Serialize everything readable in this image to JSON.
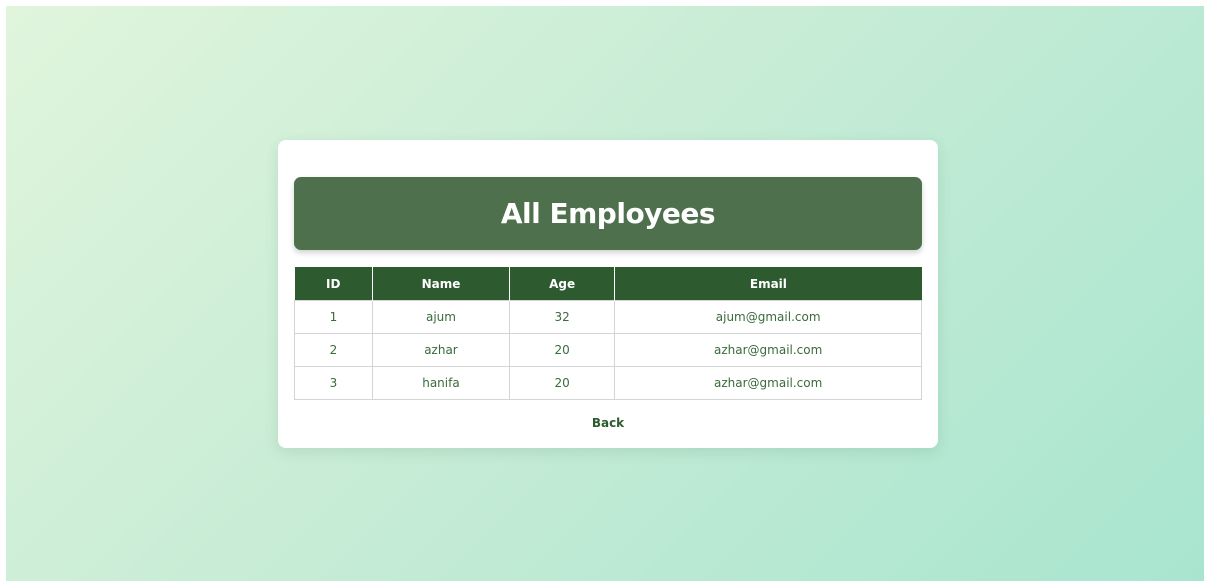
{
  "page": {
    "title": "All Employees"
  },
  "table": {
    "headers": [
      "ID",
      "Name",
      "Age",
      "Email"
    ],
    "rows": [
      {
        "id": "1",
        "name": "ajum",
        "age": "32",
        "email": "ajum@gmail.com"
      },
      {
        "id": "2",
        "name": "azhar",
        "age": "20",
        "email": "azhar@gmail.com"
      },
      {
        "id": "3",
        "name": "hanifa",
        "age": "20",
        "email": "azhar@gmail.com"
      }
    ]
  },
  "actions": {
    "back_label": "Back"
  },
  "colors": {
    "header_banner": "#4e704d",
    "table_header": "#2d5a2e",
    "cell_text": "#3a6b3b",
    "background_start": "#e0f5dc",
    "background_end": "#a8e5cf"
  }
}
